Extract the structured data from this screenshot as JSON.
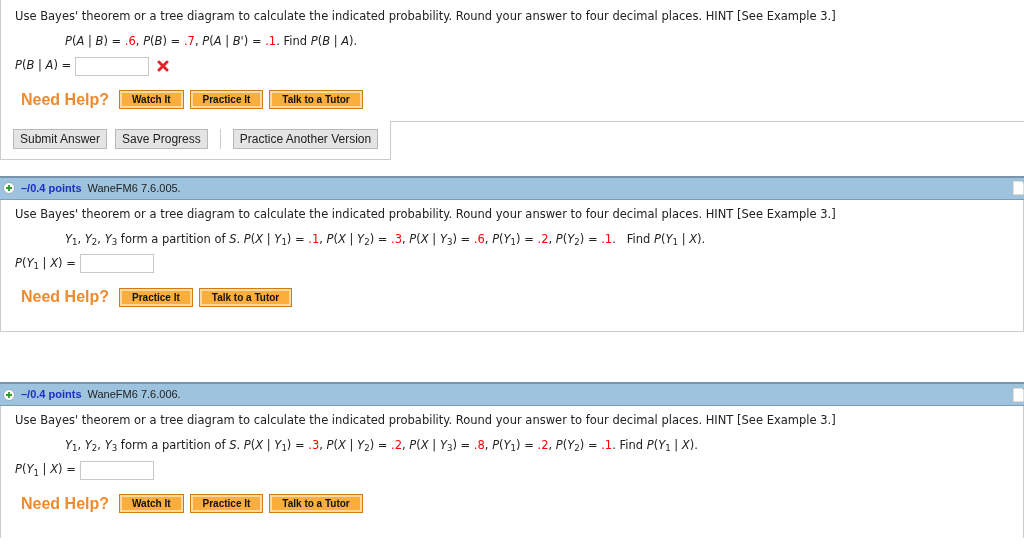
{
  "questions": [
    {
      "instructions": "Use Bayes' theorem or a tree diagram to calculate the indicated probability. Round your answer to four decimal places. HINT [See Example 3.]",
      "statement": [
        {
          "kind": "text",
          "text": "*P*(*A* | *B*) = "
        },
        {
          "kind": "value",
          "text": ".6"
        },
        {
          "kind": "text",
          "text": ", *P*(*B*) = "
        },
        {
          "kind": "value",
          "text": ".7"
        },
        {
          "kind": "text",
          "text": ", *P*(*A* | *B*') = "
        },
        {
          "kind": "value",
          "text": ".1"
        },
        {
          "kind": "text",
          "text": ". Find *P*(*B* | *A*)."
        }
      ],
      "answer_label": "*P*(*B* | *A*) =",
      "incorrect": true,
      "need_help": "Need Help?",
      "help_buttons": [
        "Watch It",
        "Practice It",
        "Talk to a Tutor"
      ],
      "actions": [
        "Submit Answer",
        "Save Progress"
      ],
      "extra_action": "Practice Another Version"
    },
    {
      "header": {
        "points": "–/0.4 points",
        "id": "WaneFM6 7.6.005."
      },
      "instructions": "Use Bayes' theorem or a tree diagram to calculate the indicated probability. Round your answer to four decimal places. HINT [See Example 3.]",
      "statement": [
        {
          "kind": "text",
          "text": "*Y*$_{1}$, *Y*$_{2}$, *Y*$_{3}$ form a partition of *S*. *P*(*X* | *Y*$_{1}$) = "
        },
        {
          "kind": "value",
          "text": ".1"
        },
        {
          "kind": "text",
          "text": ", *P*(*X* | *Y*$_{2}$) = "
        },
        {
          "kind": "value",
          "text": ".3"
        },
        {
          "kind": "text",
          "text": ", *P*(*X* | *Y*$_{3}$) = "
        },
        {
          "kind": "value",
          "text": ".6"
        },
        {
          "kind": "text",
          "text": ", *P*(*Y*$_{1}$) = "
        },
        {
          "kind": "value",
          "text": ".2"
        },
        {
          "kind": "text",
          "text": ", *P*(*Y*$_{2}$) = "
        },
        {
          "kind": "value",
          "text": ".1"
        },
        {
          "kind": "text",
          "text": ".   Find *P*(*Y*$_{1}$ | *X*)."
        }
      ],
      "answer_label": "*P*(*Y*$_{1}$ | *X*) =",
      "incorrect": false,
      "need_help": "Need Help?",
      "help_buttons": [
        "Practice It",
        "Talk to a Tutor"
      ]
    },
    {
      "header": {
        "points": "–/0.4 points",
        "id": "WaneFM6 7.6.006."
      },
      "instructions": "Use Bayes' theorem or a tree diagram to calculate the indicated probability. Round your answer to four decimal places. HINT [See Example 3.]",
      "statement": [
        {
          "kind": "text",
          "text": "*Y*$_{1}$, *Y*$_{2}$, *Y*$_{3}$ form a partition of *S*. *P*(*X* | *Y*$_{1}$) = "
        },
        {
          "kind": "value",
          "text": ".3"
        },
        {
          "kind": "text",
          "text": ", *P*(*X* | *Y*$_{2}$) = "
        },
        {
          "kind": "value",
          "text": ".2"
        },
        {
          "kind": "text",
          "text": ", *P*(*X* | *Y*$_{3}$) = "
        },
        {
          "kind": "value",
          "text": ".8"
        },
        {
          "kind": "text",
          "text": ", *P*(*Y*$_{1}$) = "
        },
        {
          "kind": "value",
          "text": ".2"
        },
        {
          "kind": "text",
          "text": ", *P*(*Y*$_{2}$) = "
        },
        {
          "kind": "value",
          "text": ".1"
        },
        {
          "kind": "text",
          "text": ". Find *P*(*Y*$_{1}$ | *X*)."
        }
      ],
      "answer_label": "*P*(*Y*$_{1}$ | *X*) =",
      "incorrect": false,
      "need_help": "Need Help?",
      "help_buttons": [
        "Watch It",
        "Practice It",
        "Talk to a Tutor"
      ]
    }
  ]
}
